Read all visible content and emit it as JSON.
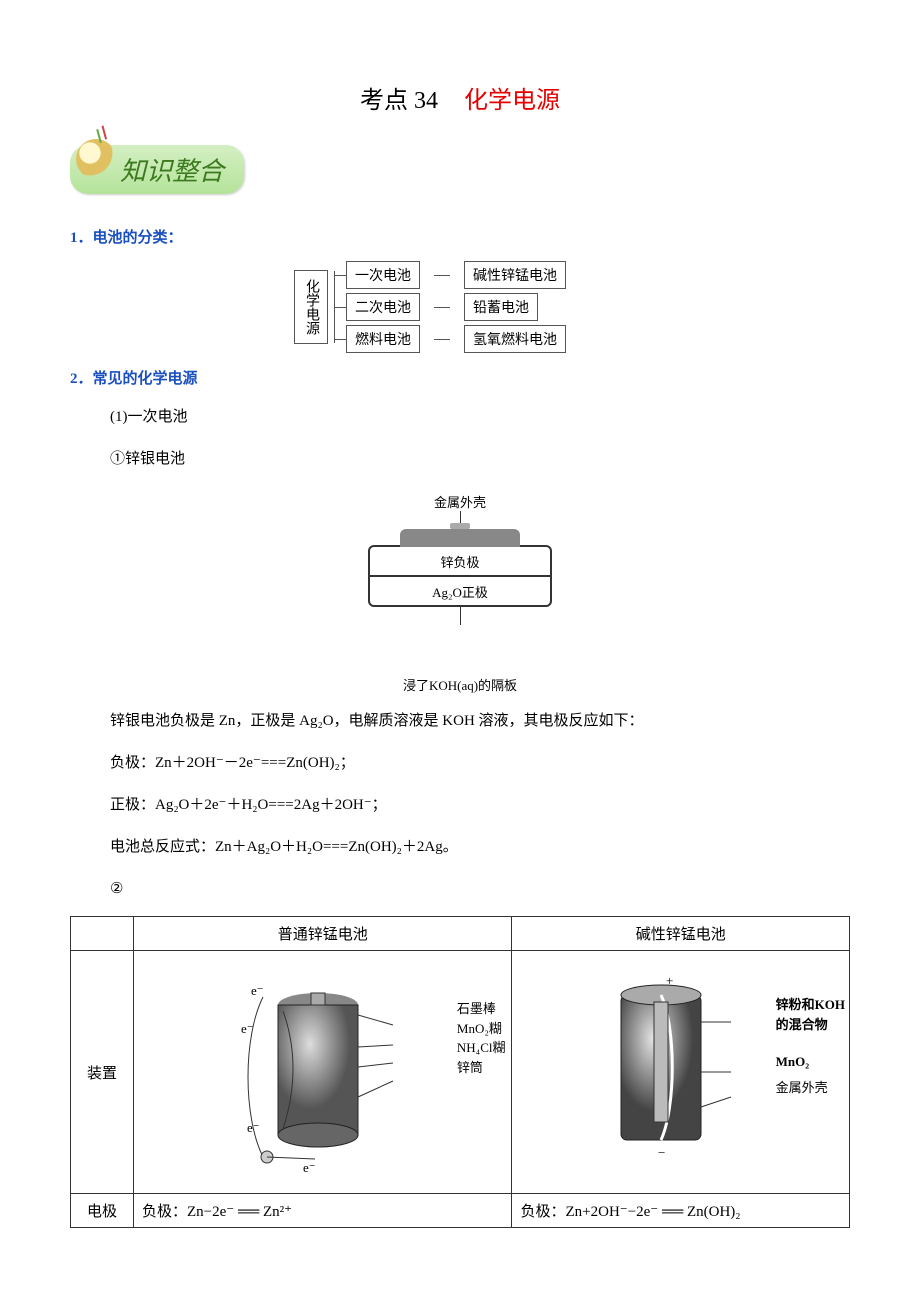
{
  "title": {
    "prefix": "考点 34",
    "main": "化学电源"
  },
  "badge": "知识整合",
  "h1": "1．电池的分类：",
  "tree": {
    "root": "化学电源",
    "rows": [
      {
        "a": "一次电池",
        "b": "碱性锌锰电池"
      },
      {
        "a": "二次电池",
        "b": "铅蓄电池"
      },
      {
        "a": "燃料电池",
        "b": "氢氧燃料电池"
      }
    ]
  },
  "h2": "2．常见的化学电源",
  "s1": "(1)一次电池",
  "s1a": "①锌银电池",
  "cell_diagram": {
    "top": "金属外壳",
    "band1": "锌负极",
    "band2": "Ag₂O正极",
    "bottom": "浸了KOH(aq)的隔板"
  },
  "p1": "锌银电池负极是 Zn，正极是 Ag₂O，电解质溶液是 KOH 溶液，其电极反应如下：",
  "p2": "负极：Zn＋2OH⁻－2e⁻===Zn(OH)₂；",
  "p3": "正极：Ag₂O＋2e⁻＋H₂O===2Ag＋2OH⁻；",
  "p4": "电池总反应式：Zn＋Ag₂O＋H₂O===Zn(OH)₂＋2Ag。",
  "s1b": "②",
  "table": {
    "col1": "普通锌锰电池",
    "col2": "碱性锌锰电池",
    "rowA": "装置",
    "rowB": "电极",
    "labelsA": {
      "a": "石墨棒",
      "b": "MnO₂糊",
      "c": "NH₄Cl糊",
      "d": "锌筒",
      "e": "e⁻"
    },
    "labelsB": {
      "a": "锌粉和KOH",
      "b": "的混合物",
      "c": "MnO₂",
      "d": "金属外壳"
    },
    "eqA": "负极：Zn−2e⁻ ══ Zn²⁺",
    "eqB": "负极：Zn+2OH⁻−2e⁻ ══ Zn(OH)₂"
  }
}
